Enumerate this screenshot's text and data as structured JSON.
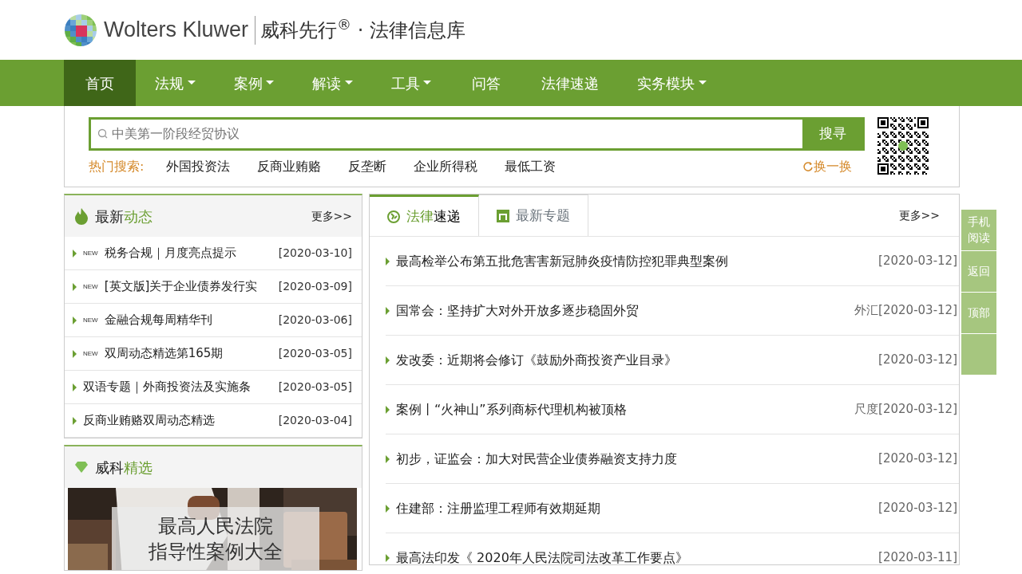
{
  "header": {
    "brand": "Wolters Kluwer",
    "product": "威科先行",
    "product_mark": "®",
    "dot": "·",
    "subtitle": "法律信息库"
  },
  "nav": [
    {
      "label": "首页",
      "selected": true,
      "dropdown": false
    },
    {
      "label": "法规",
      "selected": false,
      "dropdown": true
    },
    {
      "label": "案例",
      "selected": false,
      "dropdown": true
    },
    {
      "label": "解读",
      "selected": false,
      "dropdown": true
    },
    {
      "label": "工具",
      "selected": false,
      "dropdown": true
    },
    {
      "label": "问答",
      "selected": false,
      "dropdown": false
    },
    {
      "label": "法律速递",
      "selected": false,
      "dropdown": false
    },
    {
      "label": "实务模块",
      "selected": false,
      "dropdown": true
    }
  ],
  "search": {
    "placeholder": "中美第一阶段经贸协议",
    "button": "搜寻",
    "hot_label": "热门搜索:",
    "hot": [
      "外国投资法",
      "反商业贿赂",
      "反垄断",
      "企业所得税",
      "最低工资"
    ],
    "refresh": "换一换"
  },
  "latest": {
    "title_main": "最新",
    "title_accent": "动态",
    "more": "更多>>",
    "items": [
      {
        "badge": "NEW",
        "title": "税务合规｜月度亮点提示",
        "date": "[2020-03-10]"
      },
      {
        "badge": "NEW",
        "title": "[英文版]关于企业债券发行实",
        "date": "[2020-03-09]"
      },
      {
        "badge": "NEW",
        "title": "金融合规每周精华刊",
        "date": "[2020-03-06]"
      },
      {
        "badge": "NEW",
        "title": "双周动态精选第165期",
        "date": "[2020-03-05]"
      },
      {
        "title": "双语专题｜外商投资法及实施条",
        "date": "[2020-03-05]"
      },
      {
        "title": "反商业贿赂双周动态精选",
        "date": "[2020-03-04]"
      }
    ]
  },
  "featured": {
    "title_main": "威科",
    "title_accent": "精选",
    "banner_lines": [
      "最高人民法院",
      "指导性案例大全"
    ]
  },
  "news": {
    "tabs": [
      {
        "label_accent": "法律",
        "label_main": "速递",
        "selected": true
      },
      {
        "label_main": "最新专题",
        "selected": false
      }
    ],
    "more": "更多>>",
    "items": [
      {
        "title": "最高检举公布第五批危害害新冠肺炎疫情防控犯罪典型案例",
        "date": "[2020-03-12]"
      },
      {
        "title": "国常会：坚持扩大对外开放多逐步稳固外贸",
        "source": "外汇",
        "date": "[2020-03-12]"
      },
      {
        "title": "发改委：近期将会修订《鼓励外商投资产业目录》",
        "date": "[2020-03-12]"
      },
      {
        "title": "案例丨“火神山”系列商标代理机构被顶格",
        "source": "尺度",
        "date": "[2020-03-12]"
      },
      {
        "title": "初步，证监会：加大对民营企业债券融资支持力度",
        "date": "[2020-03-12]"
      },
      {
        "title": "住建部：注册监理工程师有效期延期",
        "date": "[2020-03-12]"
      },
      {
        "title": "最高法印发《 2020年人民法院司法改革工作要点》",
        "date": "[2020-03-11]"
      }
    ]
  },
  "side_buttons": [
    "手机阅读",
    "返回",
    "顶部"
  ]
}
